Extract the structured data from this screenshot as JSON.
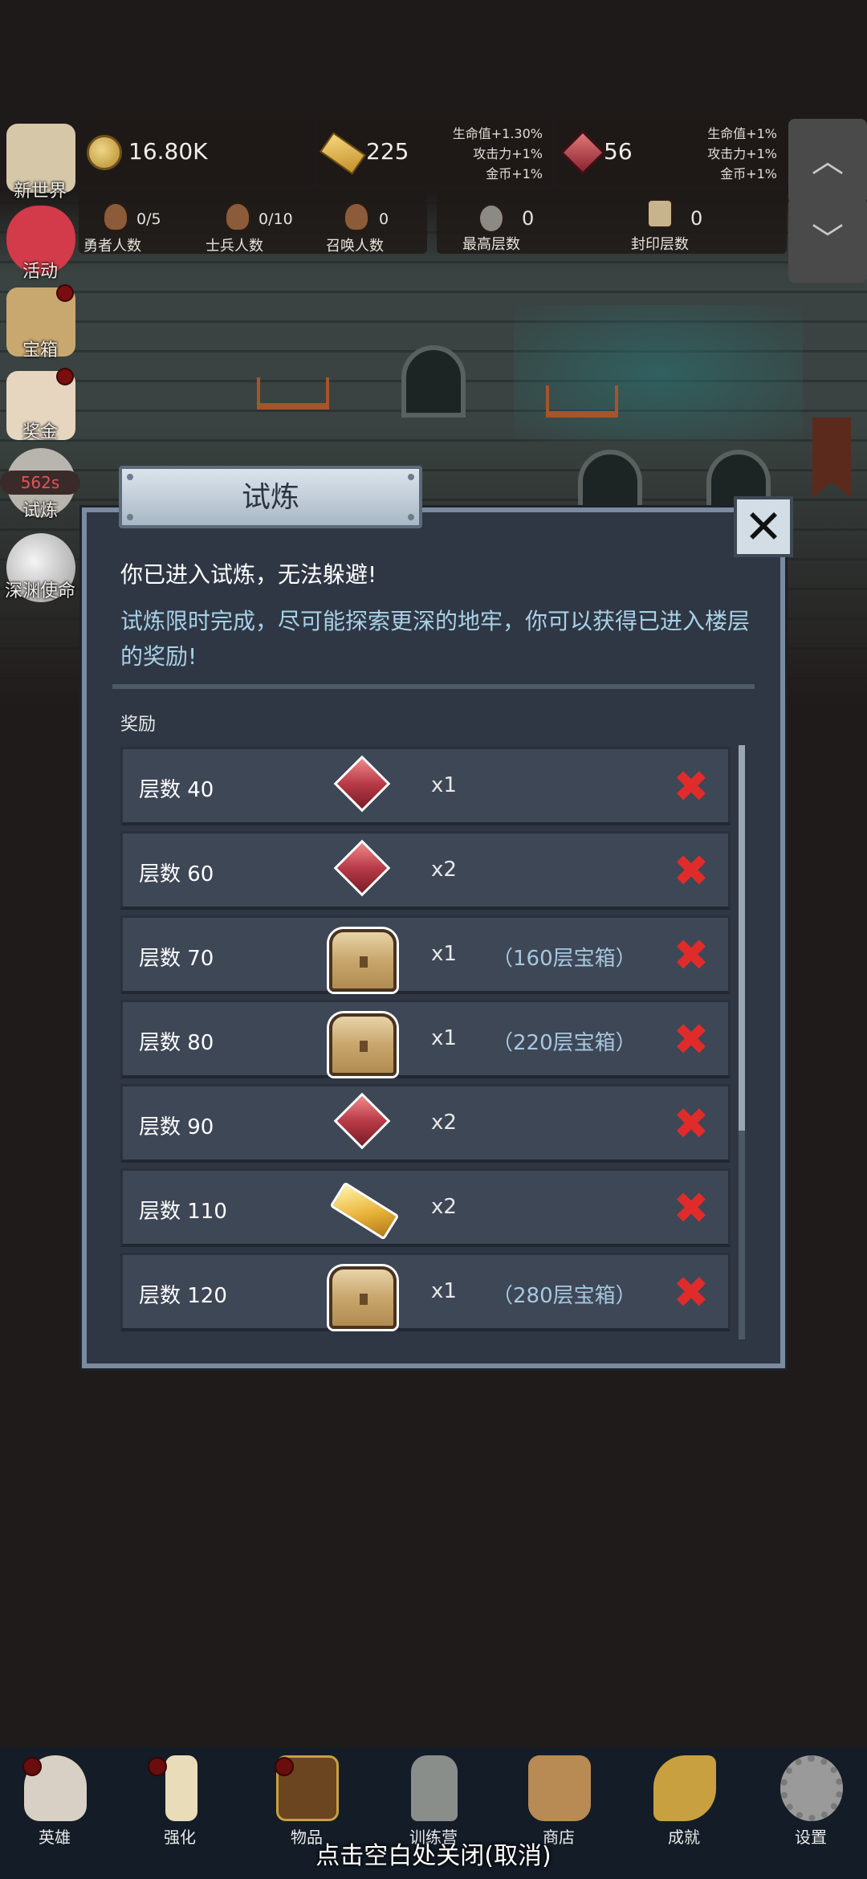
{
  "resources": {
    "coins": "16.80K",
    "gold": "225",
    "gold_bonus": [
      "生命值+1.30%",
      "攻击力+1%",
      "金币+1%"
    ],
    "gems": "56",
    "gem_bonus": [
      "生命值+1%",
      "攻击力+1%",
      "金币+1%"
    ]
  },
  "stats": [
    {
      "icon": "hero-portrait-icon",
      "value": "0/5",
      "label": "勇者人数"
    },
    {
      "icon": "soldier-portrait-icon",
      "value": "0/10",
      "label": "士兵人数"
    },
    {
      "icon": "summon-portrait-icon",
      "value": "0",
      "label": "召唤人数"
    },
    {
      "icon": "stone-icon",
      "value": "0",
      "label": "最高层数"
    },
    {
      "icon": "scroll-icon",
      "value": "0",
      "label": "封印层数"
    }
  ],
  "side_menu": [
    {
      "label": "新世界",
      "icon": "map-icon",
      "dot": false
    },
    {
      "label": "活动",
      "icon": "heart-icon",
      "dot": false
    },
    {
      "label": "宝箱",
      "icon": "chest-icon",
      "dot": true
    },
    {
      "label": "奖金",
      "icon": "envelope-icon",
      "dot": true
    },
    {
      "label": "试炼",
      "icon": "trial-icon",
      "dot": false,
      "badge": "562s"
    },
    {
      "label": "深渊使命",
      "icon": "orb-icon",
      "dot": false
    }
  ],
  "dialog": {
    "title": "试炼",
    "line1": "你已进入试炼，无法躲避!",
    "line2": "试炼限时完成，尽可能探索更深的地牢，你可以获得已进入楼层的奖励!",
    "section_label": "奖励",
    "rewards": [
      {
        "floor": "层数 40",
        "item": "gem",
        "qty": "x1",
        "note": ""
      },
      {
        "floor": "层数 60",
        "item": "gem",
        "qty": "x2",
        "note": ""
      },
      {
        "floor": "层数 70",
        "item": "chest",
        "qty": "x1",
        "note": "（160层宝箱）"
      },
      {
        "floor": "层数 80",
        "item": "chest",
        "qty": "x1",
        "note": "（220层宝箱）"
      },
      {
        "floor": "层数 90",
        "item": "gem",
        "qty": "x2",
        "note": ""
      },
      {
        "floor": "层数 110",
        "item": "gold",
        "qty": "x2",
        "note": ""
      },
      {
        "floor": "层数 120",
        "item": "chest",
        "qty": "x1",
        "note": "（280层宝箱）"
      }
    ],
    "status_glyph": "✖"
  },
  "bottom_nav": [
    {
      "label": "英雄",
      "icon": "skull-icon",
      "dot": true
    },
    {
      "label": "强化",
      "icon": "candle-icon",
      "dot": true
    },
    {
      "label": "物品",
      "icon": "book-icon",
      "dot": true
    },
    {
      "label": "训练营",
      "icon": "lantern-icon",
      "dot": false
    },
    {
      "label": "商店",
      "icon": "mug-icon",
      "dot": false
    },
    {
      "label": "成就",
      "icon": "key-icon",
      "dot": false
    },
    {
      "label": "设置",
      "icon": "gear-icon",
      "dot": false
    }
  ],
  "close_hint": "点击空白处关闭(取消)",
  "colors": {
    "accent_text": "#a8d0e6",
    "panel": "#2f3744",
    "status_red": "#e02b2b"
  }
}
